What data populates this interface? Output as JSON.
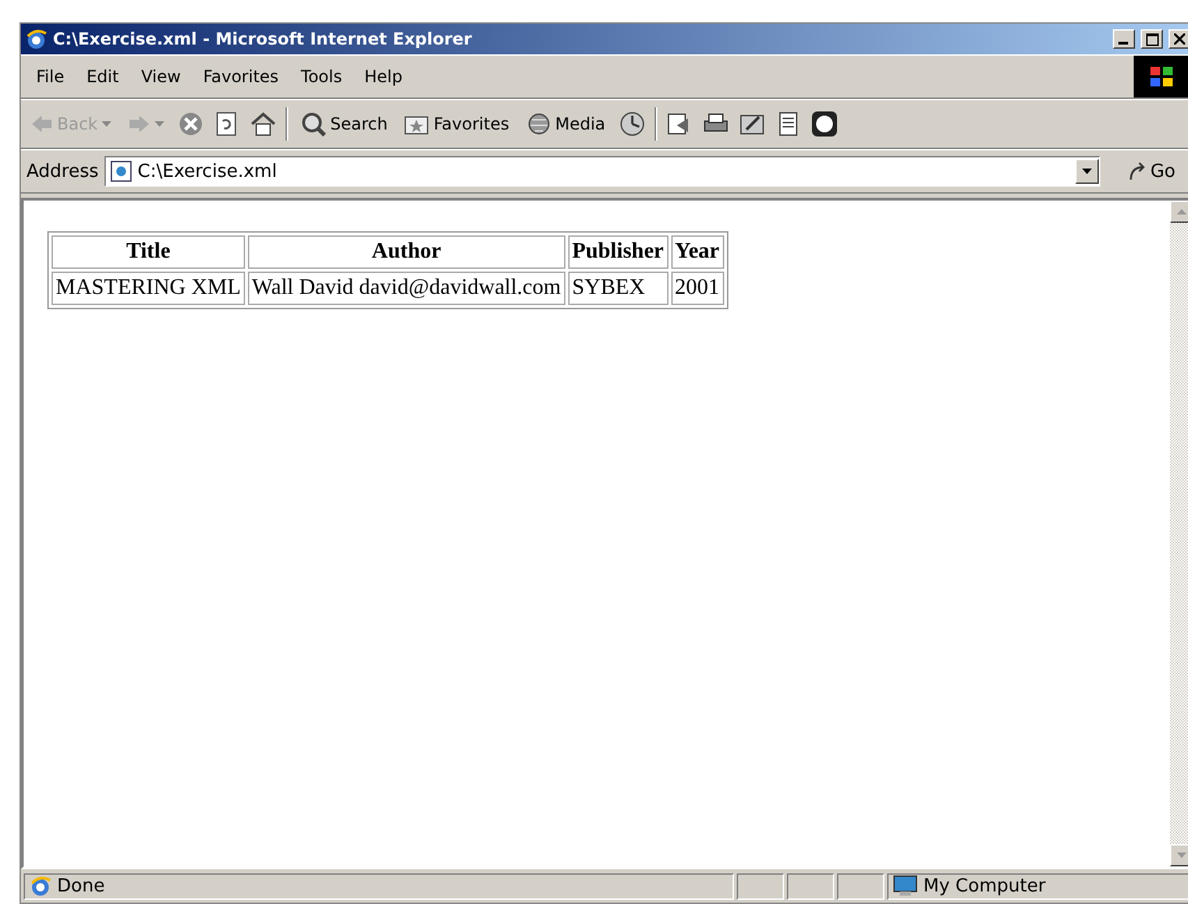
{
  "window": {
    "title": "C:\\Exercise.xml - Microsoft Internet Explorer"
  },
  "menu": [
    "File",
    "Edit",
    "View",
    "Favorites",
    "Tools",
    "Help"
  ],
  "toolbar": {
    "back": {
      "label": "Back",
      "disabled": true
    },
    "search": "Search",
    "favorites": "Favorites",
    "media": "Media"
  },
  "address": {
    "label": "Address",
    "value": "C:\\Exercise.xml",
    "go": "Go"
  },
  "table": {
    "columns": [
      "Title",
      "Author",
      "Publisher",
      "Year"
    ],
    "rows": [
      [
        "MASTERING XML",
        "Wall David david@davidwall.com",
        "SYBEX",
        "2001"
      ]
    ]
  },
  "status_bar": {
    "text": "Done",
    "zone": "My Computer"
  }
}
